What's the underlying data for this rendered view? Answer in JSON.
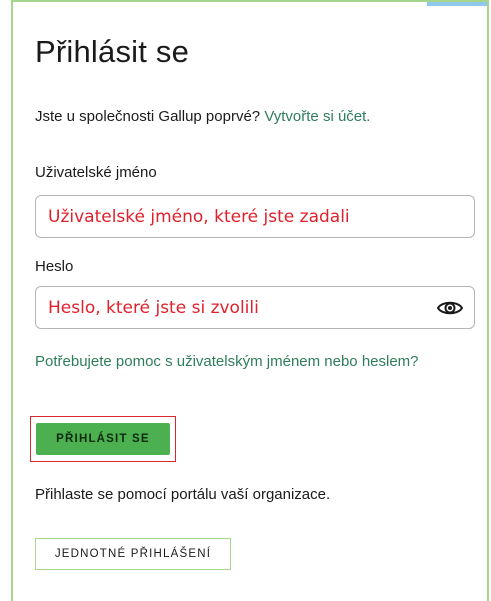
{
  "colors": {
    "accent_green": "#4caf50",
    "link_green": "#2e7d5b",
    "border_green": "#a6d68b",
    "annotation_red": "#e0202b",
    "highlight_red": "#d9272e"
  },
  "login": {
    "title": "Přihlásit se",
    "intro_text": "Jste u společnosti Gallup poprvé? ",
    "create_account_link": "Vytvořte si účet.",
    "username_label": "Uživatelské jméno",
    "username_value": "Uživatelské jméno, které jste zadali",
    "password_label": "Heslo",
    "password_value": "Heslo, které jste si zvolili",
    "password_visibility_icon": "eye-icon",
    "help_link": "Potřebujete pomoc s uživatelským jménem nebo heslem?",
    "signin_button": "PŘIHLÁSIT SE",
    "sso_prompt": "Přihlaste se pomocí portálu vaší organizace.",
    "sso_button": "JEDNOTNÉ PŘIHLÁŠENÍ"
  }
}
